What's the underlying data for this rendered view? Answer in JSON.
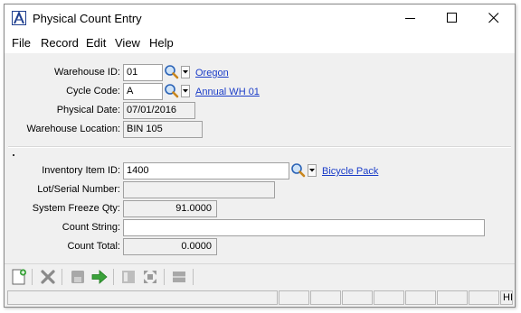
{
  "window": {
    "title": "Physical Count Entry"
  },
  "menu": {
    "file": "File",
    "record": "Record",
    "edit": "Edit",
    "view": "View",
    "help": "Help"
  },
  "form": {
    "warehouse_id": {
      "label": "Warehouse ID:",
      "value": "01",
      "description": "Oregon"
    },
    "cycle_code": {
      "label": "Cycle Code:",
      "value": "A",
      "description": "Annual WH 01"
    },
    "physical_date": {
      "label": "Physical Date:",
      "value": "07/01/2016"
    },
    "warehouse_location": {
      "label": "Warehouse Location:",
      "value": "BIN 105"
    },
    "inventory_item_id": {
      "label": "Inventory Item ID:",
      "value": "1400",
      "description": "Bicycle Pack"
    },
    "lot_serial_number": {
      "label": "Lot/Serial Number:",
      "value": ""
    },
    "system_freeze_qty": {
      "label": "System Freeze Qty:",
      "value": "91.0000"
    },
    "count_string": {
      "label": "Count String:",
      "value": ""
    },
    "count_total": {
      "label": "Count Total:",
      "value": "0.0000"
    }
  },
  "toolbar": {
    "icons": [
      "new-record-icon",
      "delete-icon",
      "save-icon",
      "proceed-arrow-icon",
      "first-record-icon",
      "fit-icon",
      "list-icon"
    ]
  },
  "status": {
    "last_panel": "HI"
  },
  "colors": {
    "link": "#1a3cc8",
    "window_bg": "#f0f0f0",
    "title_icon": "#1f3f8f"
  }
}
